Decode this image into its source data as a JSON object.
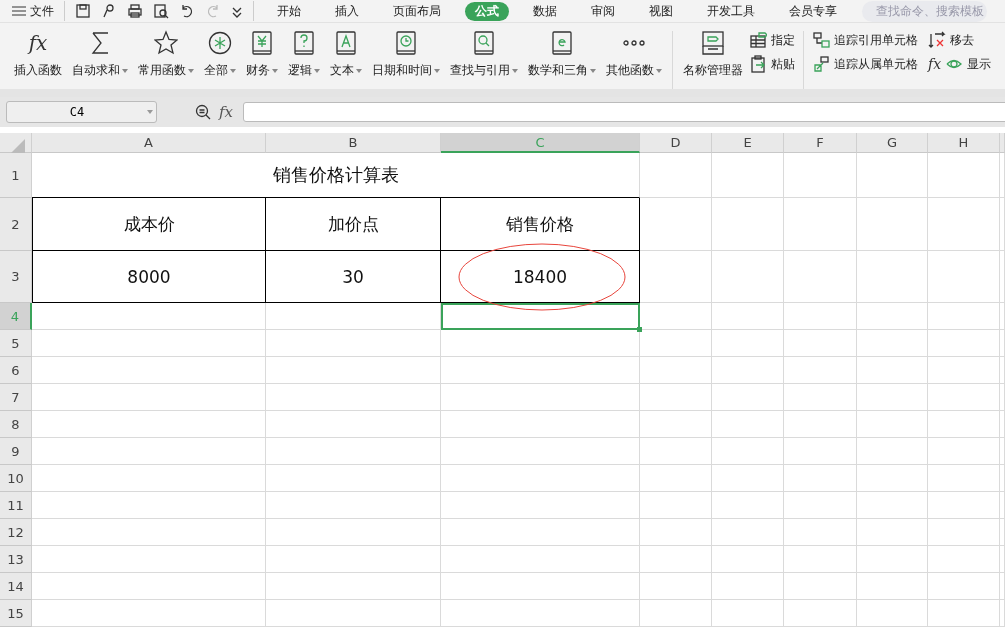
{
  "menu": {
    "file_label": "文件",
    "tabs": [
      {
        "label": "开始",
        "selected": false
      },
      {
        "label": "插入",
        "selected": false
      },
      {
        "label": "页面布局",
        "selected": false
      },
      {
        "label": "公式",
        "selected": true
      },
      {
        "label": "数据",
        "selected": false
      },
      {
        "label": "审阅",
        "selected": false
      },
      {
        "label": "视图",
        "selected": false
      },
      {
        "label": "开发工具",
        "selected": false
      },
      {
        "label": "会员专享",
        "selected": false
      }
    ],
    "search": {
      "placeholder": "查找命令、搜索模板"
    }
  },
  "ribbon": {
    "functions": [
      {
        "label": "插入函数",
        "dropdown": false,
        "symbol": "fx"
      },
      {
        "label": "自动求和",
        "dropdown": true
      },
      {
        "label": "常用函数",
        "dropdown": true
      },
      {
        "label": "全部",
        "dropdown": true
      },
      {
        "label": "财务",
        "dropdown": true
      },
      {
        "label": "逻辑",
        "dropdown": true
      },
      {
        "label": "文本",
        "dropdown": true
      },
      {
        "label": "日期和时间",
        "dropdown": true
      },
      {
        "label": "查找与引用",
        "dropdown": true
      },
      {
        "label": "数学和三角",
        "dropdown": true
      },
      {
        "label": "其他函数",
        "dropdown": true
      }
    ],
    "names": {
      "manager": "名称管理器",
      "small": [
        "指定",
        "粘贴"
      ]
    },
    "audit": [
      "追踪引用单元格",
      "追踪从属单元格",
      "移去",
      "显示"
    ],
    "show_formula_symbol": "fx"
  },
  "formula_bar": {
    "name_box": "C4",
    "fx_symbol": "fx"
  },
  "sheet": {
    "columns": [
      {
        "label": "A",
        "selected": false
      },
      {
        "label": "B",
        "selected": false
      },
      {
        "label": "C",
        "selected": true
      },
      {
        "label": "D",
        "selected": false
      },
      {
        "label": "E",
        "selected": false
      },
      {
        "label": "F",
        "selected": false
      },
      {
        "label": "G",
        "selected": false
      },
      {
        "label": "H",
        "selected": false
      }
    ],
    "rows": [
      {
        "label": "1",
        "selected": false
      },
      {
        "label": "2",
        "selected": false
      },
      {
        "label": "3",
        "selected": false
      },
      {
        "label": "4",
        "selected": true
      },
      {
        "label": "5",
        "selected": false
      },
      {
        "label": "6",
        "selected": false
      },
      {
        "label": "7",
        "selected": false
      },
      {
        "label": "8",
        "selected": false
      },
      {
        "label": "9",
        "selected": false
      },
      {
        "label": "10",
        "selected": false
      },
      {
        "label": "11",
        "selected": false
      },
      {
        "label": "12",
        "selected": false
      },
      {
        "label": "13",
        "selected": false
      },
      {
        "label": "14",
        "selected": false
      },
      {
        "label": "15",
        "selected": false
      }
    ],
    "title": "销售价格计算表",
    "header": [
      "成本价",
      "加价点",
      "销售价格"
    ],
    "values": [
      "8000",
      "30",
      "18400"
    ]
  }
}
